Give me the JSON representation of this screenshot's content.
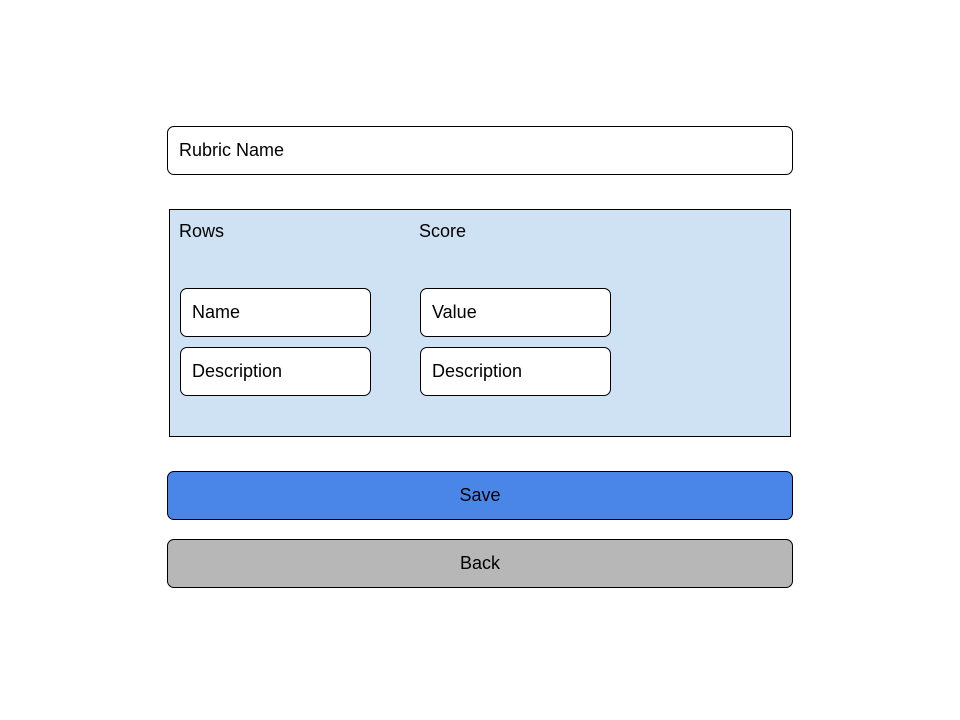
{
  "form": {
    "rubric_name_placeholder": "Rubric Name"
  },
  "panel": {
    "rows_label": "Rows",
    "score_label": "Score",
    "rows": {
      "name_placeholder": "Name",
      "description_placeholder": "Description"
    },
    "score": {
      "value_placeholder": "Value",
      "description_placeholder": "Description"
    }
  },
  "actions": {
    "save_label": "Save",
    "back_label": "Back"
  },
  "colors": {
    "panel_background": "#cfe2f3",
    "save_button": "#4a86e8",
    "back_button": "#b7b7b7"
  }
}
